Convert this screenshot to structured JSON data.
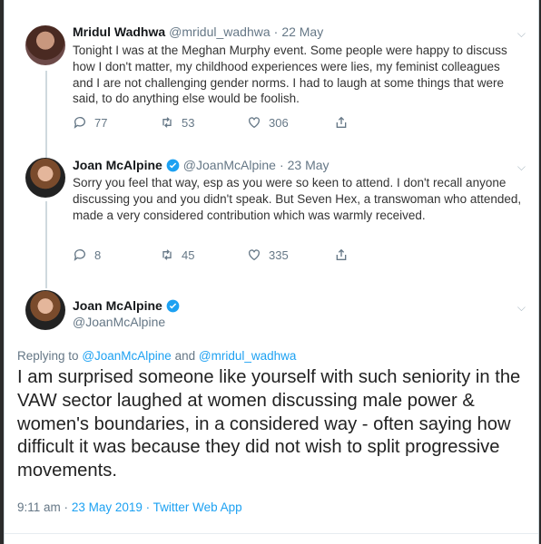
{
  "tweets": [
    {
      "name": "Mridul Wadhwa",
      "handle": "@mridul_wadhwa",
      "sep": "·",
      "date": "22 May",
      "text": "Tonight I was at the Meghan Murphy event. Some people  were happy to discuss how I don't matter, my childhood experiences were lies, my feminist colleagues and I are not challenging gender norms. I had to laugh at some things that were said, to do anything else would be foolish.",
      "replies": "77",
      "retweets": "53",
      "likes": "306",
      "verified": false
    },
    {
      "name": "Joan McAlpine",
      "handle": "@JoanMcAlpine",
      "sep": "·",
      "date": "23 May",
      "text": "Sorry you feel that way, esp as you were so keen to attend. I don't recall anyone discussing you and you didn't speak. But Seven Hex, a transwoman who attended, made a very considered contribution which was warmly received.",
      "replies": "8",
      "retweets": "45",
      "likes": "335",
      "verified": true
    }
  ],
  "main_tweet": {
    "name": "Joan McAlpine",
    "handle": "@JoanMcAlpine",
    "verified": true,
    "replying_label": "Replying to",
    "mention1": "@JoanMcAlpine",
    "and": "and",
    "mention2": "@mridul_wadhwa",
    "text": "I am surprised someone like yourself with such seniority in the VAW sector laughed at women discussing male power &  women's boundaries, in a considered way - often saying how difficult it was because they did not wish to split progressive movements.",
    "timestamp": "9:11 am",
    "sep": "·",
    "source": "23 May 2019 · Twitter Web App"
  },
  "colors": {
    "link": "#1da1f2",
    "muted": "#657786",
    "text": "#14171a"
  },
  "icons": [
    "reply-icon",
    "retweet-icon",
    "heart-icon",
    "share-icon",
    "verified-badge-icon",
    "chevron-down-icon"
  ]
}
